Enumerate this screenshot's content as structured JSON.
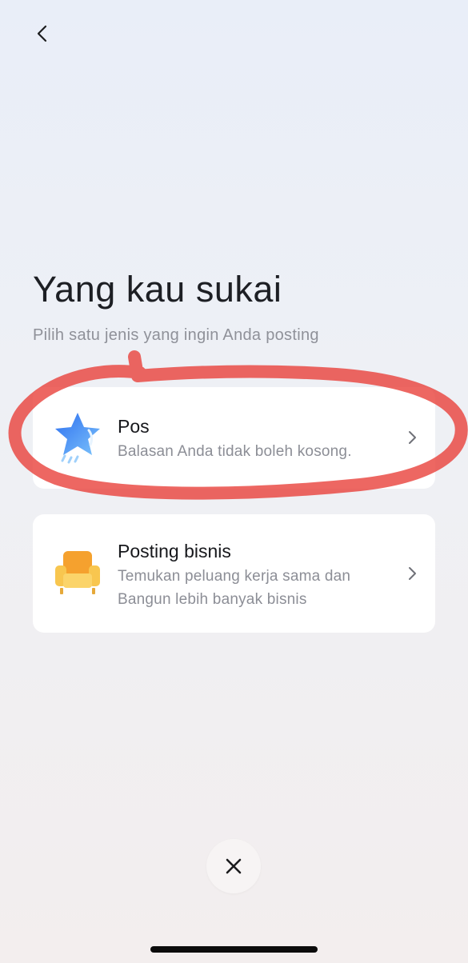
{
  "header": {
    "back_icon": "chevron-left-icon"
  },
  "main": {
    "title": "Yang kau sukai",
    "subtitle": "Pilih satu jenis yang ingin Anda posting",
    "options": [
      {
        "icon": "star-icon",
        "title": "Pos",
        "description_lines": [
          "Balasan Anda tidak boleh kosong."
        ],
        "chevron_icon": "chevron-right-icon"
      },
      {
        "icon": "sofa-icon",
        "title": "Posting bisnis",
        "description_lines": [
          "Temukan peluang kerja sama dan",
          "Bangun lebih banyak bisnis"
        ],
        "chevron_icon": "chevron-right-icon"
      }
    ]
  },
  "footer": {
    "close_icon": "close-icon"
  },
  "colors": {
    "annotation": "#e8413b",
    "star_blue": "#3a8cf5",
    "sofa_yellow": "#f7c24a",
    "card_bg": "#ffffff",
    "subtitle_gray": "#8f9199"
  }
}
